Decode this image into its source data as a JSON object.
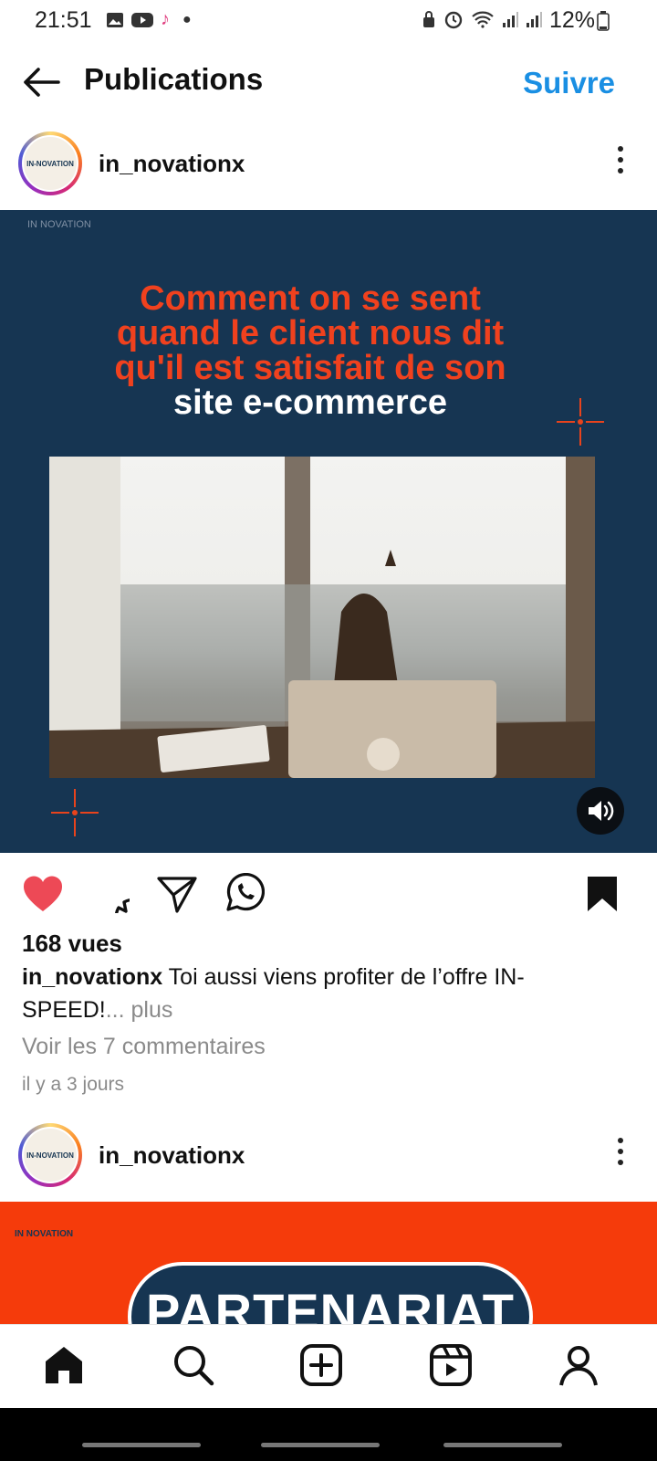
{
  "status_bar": {
    "time": "21:51",
    "battery": "12%"
  },
  "header": {
    "title": "Publications",
    "follow_label": "Suivre"
  },
  "post1": {
    "username": "in_novationx",
    "avatar_text": "IN-NOVATION",
    "media": {
      "brand": "IN NOVATION",
      "headline_lines": [
        "Comment on se sent",
        "quand le client  nous dit",
        "qu'il est satisfait de son"
      ],
      "headline_white": "site e-commerce"
    },
    "views": "168 vues",
    "caption_user": "in_novationx",
    "caption_text": " Toi aussi viens profiter de l’offre IN-SPEED!",
    "caption_more": "... plus",
    "comments_link": "Voir les 7 commentaires",
    "time_ago": "il y a 3 jours"
  },
  "post2": {
    "username": "in_novationx",
    "avatar_text": "IN-NOVATION",
    "media": {
      "brand": "IN NOVATION",
      "banner_text": "PARTENARIAT"
    }
  },
  "colors": {
    "accent": "#1a8fe3",
    "like": "#ed4956",
    "media_bg": "#163552",
    "headline": "#f0411e",
    "media2_bg": "#f53b0b"
  },
  "icons": [
    "back-arrow-icon",
    "heart-icon",
    "comment-icon",
    "share-icon",
    "whatsapp-icon",
    "bookmark-icon",
    "sound-icon",
    "home-icon",
    "search-icon",
    "create-icon",
    "reels-icon",
    "profile-icon"
  ]
}
